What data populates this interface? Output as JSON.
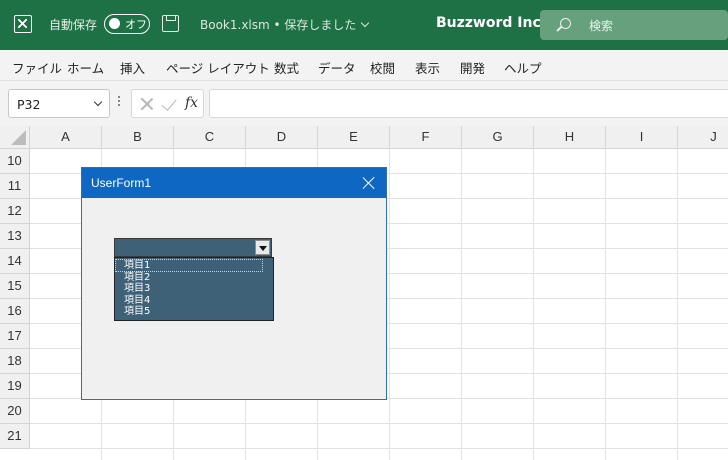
{
  "titlebar": {
    "autosave_label": "自動保存",
    "autosave_state": "オフ",
    "document": "Book1.xlsm • 保存しました",
    "company": "Buzzword Inc.",
    "search_placeholder": "検索",
    "bg_color": "#1e7145"
  },
  "menu": [
    "ファイル",
    "ホーム",
    "挿入",
    "ページ レイアウト",
    "数式",
    "データ",
    "校閲",
    "表示",
    "開発",
    "ヘルプ"
  ],
  "formula_bar": {
    "name_box": "P32",
    "fx_label": "fx",
    "formula": ""
  },
  "columns": [
    "A",
    "B",
    "C",
    "D",
    "E",
    "F",
    "G",
    "H",
    "I",
    "J"
  ],
  "rows": [
    "10",
    "11",
    "12",
    "13",
    "14",
    "15",
    "16",
    "17",
    "18",
    "19",
    "20",
    "21"
  ],
  "userform": {
    "title": "UserForm1",
    "combobox_value": "",
    "dropdown_items": [
      "項目1",
      "項目2",
      "項目3",
      "項目4",
      "項目5"
    ],
    "title_color": "#0e67c2"
  }
}
